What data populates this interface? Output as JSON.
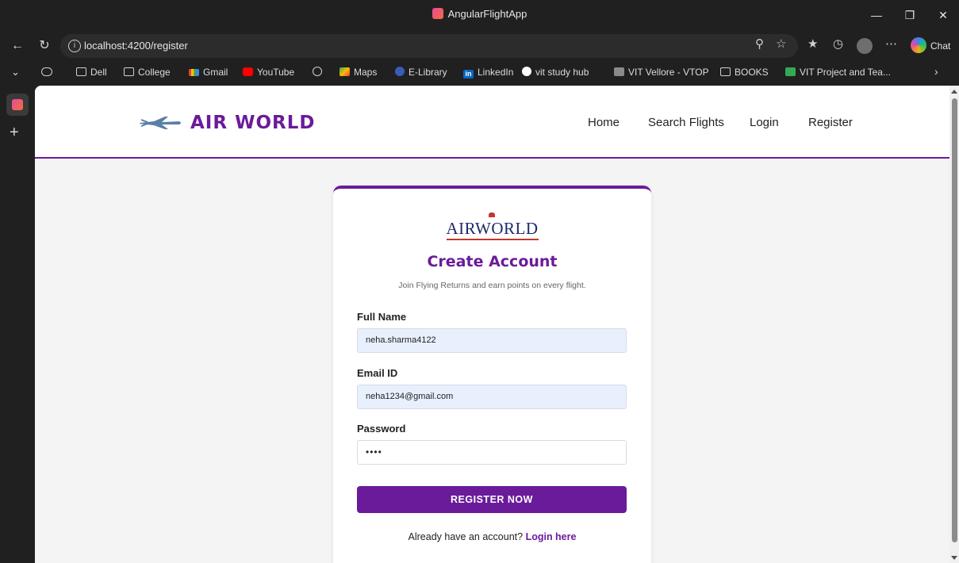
{
  "window": {
    "title": "AngularFlightApp"
  },
  "address": {
    "url": "localhost:4200/register"
  },
  "browser": {
    "chat_label": "Chat"
  },
  "bookmarks": [
    {
      "label": "Dell",
      "icon": "folder-icon"
    },
    {
      "label": "College",
      "icon": "folder-icon"
    },
    {
      "label": "Gmail",
      "icon": "gmail-icon"
    },
    {
      "label": "YouTube",
      "icon": "youtube-icon"
    },
    {
      "label": "",
      "icon": "globe-icon"
    },
    {
      "label": "Maps",
      "icon": "maps-icon"
    },
    {
      "label": "E-Library",
      "icon": "elibrary-icon"
    },
    {
      "label": "LinkedIn",
      "icon": "linkedin-icon"
    },
    {
      "label": "vit study hub",
      "icon": "vit-icon"
    },
    {
      "label": "VIT Vellore - VTOP",
      "icon": "vtop-icon"
    },
    {
      "label": "BOOKS",
      "icon": "folder-icon"
    },
    {
      "label": "VIT Project and Tea...",
      "icon": "plus-icon"
    }
  ],
  "site": {
    "brand": "AIR WORLD",
    "nav": [
      "Home",
      "Search Flights",
      "Login",
      "Register"
    ]
  },
  "card": {
    "logo_text": "AIRWORLD",
    "title": "Create Account",
    "subtitle": "Join Flying Returns and earn points on every flight.",
    "fullname_label": "Full Name",
    "fullname_value": "neha.sharma4122",
    "email_label": "Email ID",
    "email_value": "neha1234@gmail.com",
    "password_label": "Password",
    "password_value": "••••",
    "button_label": "REGISTER NOW",
    "already_text": "Already have an account?",
    "login_link": "Login here"
  },
  "colors": {
    "accent": "#6a1b9a",
    "autofill": "#e8f0fe"
  }
}
